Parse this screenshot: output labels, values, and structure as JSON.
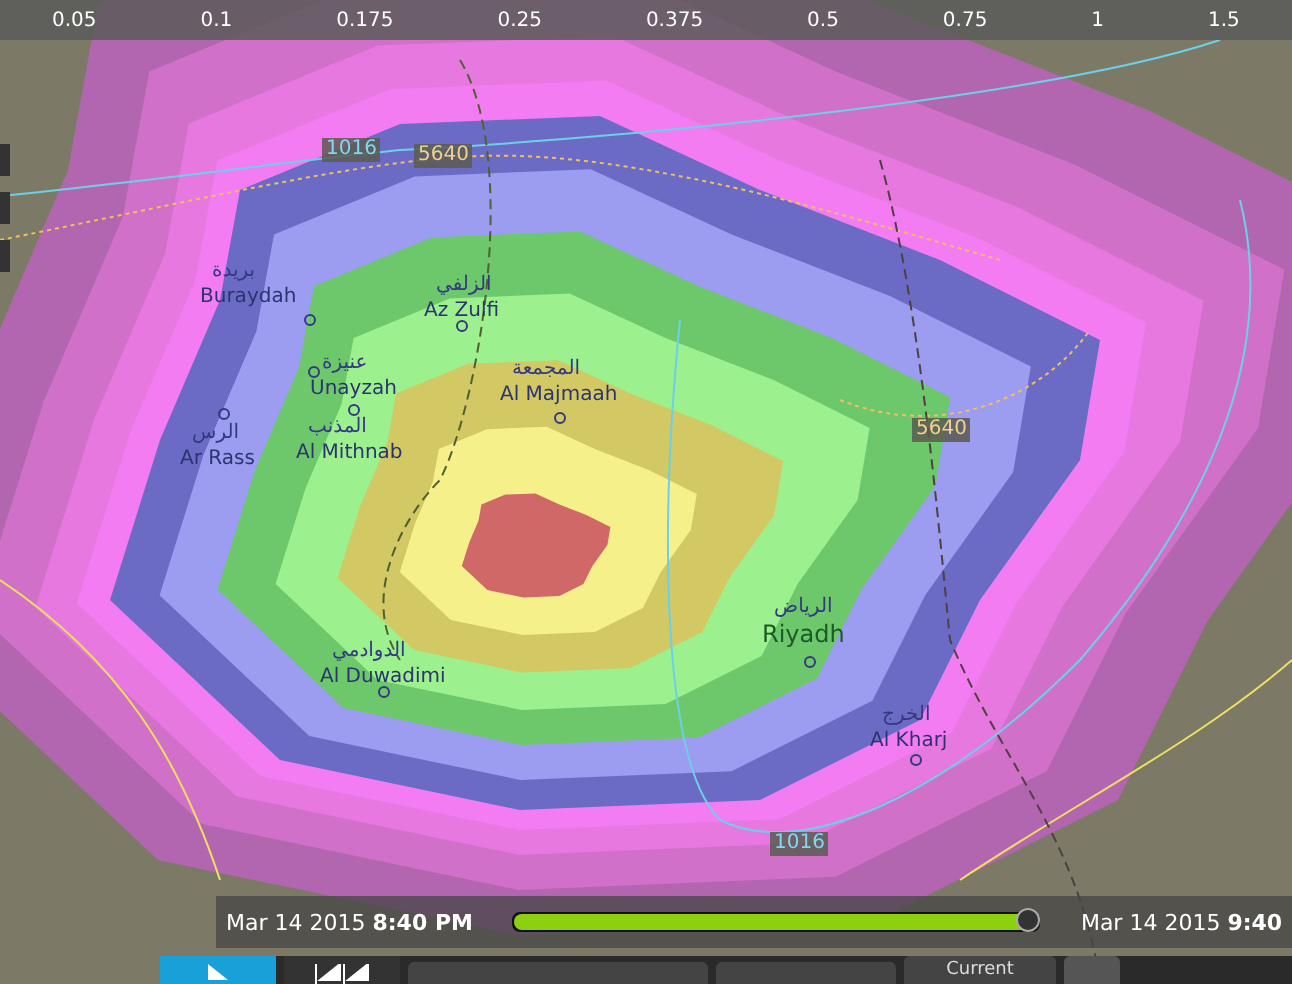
{
  "scale_bar": {
    "ticks": [
      "0.05",
      "0.1",
      "0.175",
      "0.25",
      "0.375",
      "0.5",
      "0.75",
      "1",
      "1.5"
    ]
  },
  "map": {
    "cities": [
      {
        "arabic": "بريدة",
        "name": "Buraydah"
      },
      {
        "arabic": "الزلفي",
        "name": "Az Zulfi"
      },
      {
        "arabic": "عنيزة",
        "name": "Unayzah"
      },
      {
        "arabic": "المجمعة",
        "name": "Al Majmaah"
      },
      {
        "arabic": "الرس",
        "name": "Ar Rass"
      },
      {
        "arabic": "المذنب",
        "name": "Al Mithnab"
      },
      {
        "arabic": "الدوادمي",
        "name": "Al Duwadimi"
      },
      {
        "arabic": "الرياض",
        "name": "Riyadh"
      },
      {
        "arabic": "الخرج",
        "name": "Al Kharj"
      }
    ],
    "contour_labels": [
      {
        "text": "1016"
      },
      {
        "text": "5640"
      },
      {
        "text": "5640"
      },
      {
        "text": "1016"
      }
    ]
  },
  "timeline": {
    "start_date": "Mar 14 2015",
    "start_time": "8:40 PM",
    "end_date": "Mar 14 2015",
    "end_time": "9:40",
    "level": 0.98
  },
  "controls": {
    "current_label": "Current"
  }
}
